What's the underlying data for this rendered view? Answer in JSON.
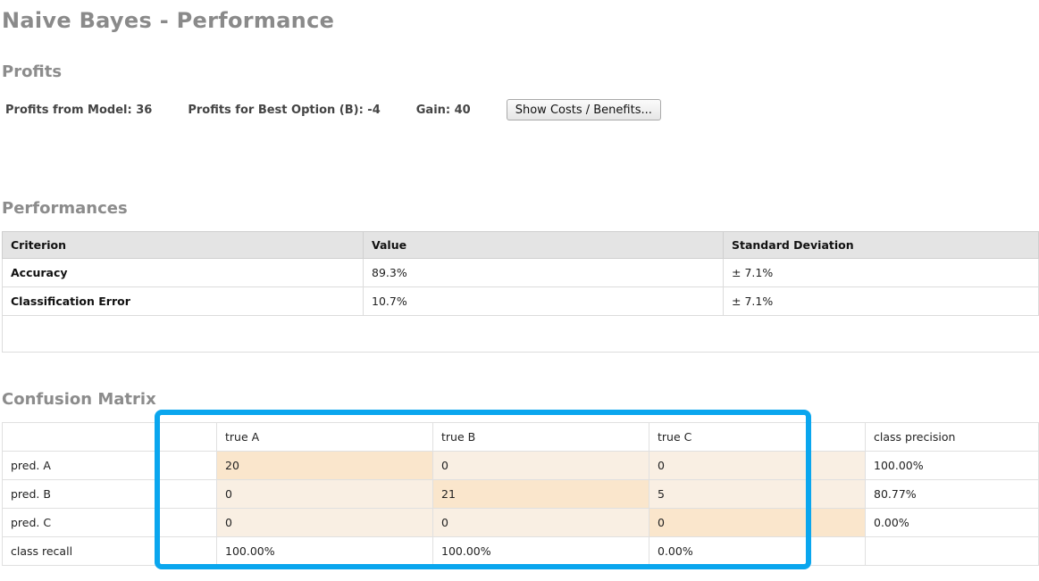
{
  "title": "Naive Bayes - Performance",
  "profits": {
    "heading": "Profits",
    "model": "Profits from Model: 36",
    "best_option": "Profits for Best Option (B): -4",
    "gain": "Gain: 40",
    "button_label": "Show Costs / Benefits..."
  },
  "performances": {
    "heading": "Performances",
    "columns": [
      "Criterion",
      "Value",
      "Standard Deviation"
    ],
    "rows": [
      {
        "criterion": "Accuracy",
        "value": "89.3%",
        "std": "± 7.1%"
      },
      {
        "criterion": "Classification Error",
        "value": "10.7%",
        "std": "± 7.1%"
      }
    ]
  },
  "confusion_matrix": {
    "heading": "Confusion Matrix",
    "columns": [
      "",
      "true A",
      "true B",
      "true C",
      "",
      "class precision"
    ],
    "rows": [
      {
        "label": "pred. A",
        "cells": [
          "20",
          "0",
          "0"
        ],
        "precision": "100.00%"
      },
      {
        "label": "pred. B",
        "cells": [
          "0",
          "21",
          "5"
        ],
        "precision": "80.77%"
      },
      {
        "label": "pred. C",
        "cells": [
          "0",
          "0",
          "0"
        ],
        "precision": "0.00%"
      },
      {
        "label": "class recall",
        "cells": [
          "100.00%",
          "100.00%",
          "0.00%"
        ],
        "precision": ""
      }
    ],
    "highlight_color": "#0aa6ee"
  }
}
